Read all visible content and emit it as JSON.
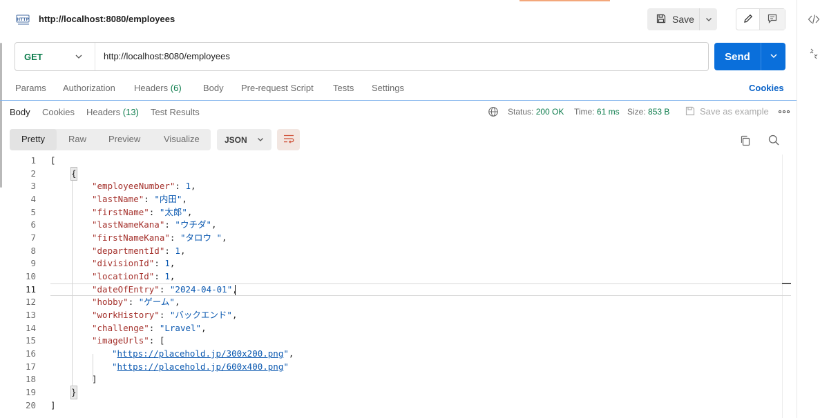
{
  "request": {
    "title": "http://localhost:8080/employees",
    "method": "GET",
    "url": "http://localhost:8080/employees",
    "save_label": "Save",
    "send_label": "Send"
  },
  "request_tabs": {
    "params": "Params",
    "authorization": "Authorization",
    "headers": "Headers",
    "headers_count": "(6)",
    "body": "Body",
    "prerequest": "Pre-request Script",
    "tests": "Tests",
    "settings": "Settings",
    "cookies": "Cookies"
  },
  "response_tabs": {
    "body": "Body",
    "cookies": "Cookies",
    "headers": "Headers",
    "headers_count": "(13)",
    "test_results": "Test Results"
  },
  "response_status": {
    "status_label": "Status:",
    "status_value": "200 OK",
    "time_label": "Time:",
    "time_value": "61 ms",
    "size_label": "Size:",
    "size_value": "853 B",
    "save_example": "Save as example"
  },
  "view_options": {
    "pretty": "Pretty",
    "raw": "Raw",
    "preview": "Preview",
    "visualize": "Visualize",
    "format": "JSON"
  },
  "code": {
    "line_numbers": [
      "1",
      "2",
      "3",
      "4",
      "5",
      "6",
      "7",
      "8",
      "9",
      "10",
      "11",
      "12",
      "13",
      "14",
      "15",
      "16",
      "17",
      "18",
      "19",
      "20"
    ],
    "l1": "[",
    "l2": "{",
    "l3_key": "\"employeeNumber\"",
    "l3_val": "1",
    "l4_key": "\"lastName\"",
    "l4_val": "\"内田\"",
    "l5_key": "\"firstName\"",
    "l5_val": "\"太郎\"",
    "l6_key": "\"lastNameKana\"",
    "l6_val": "\"ウチダ\"",
    "l7_key": "\"firstNameKana\"",
    "l7_val": "\"タロウ \"",
    "l8_key": "\"departmentId\"",
    "l8_val": "1",
    "l9_key": "\"divisionId\"",
    "l9_val": "1",
    "l10_key": "\"locationId\"",
    "l10_val": "1",
    "l11_key": "\"dateOfEntry\"",
    "l11_val": "\"2024-04-01\"",
    "l12_key": "\"hobby\"",
    "l12_val": "\"ゲーム\"",
    "l13_key": "\"workHistory\"",
    "l13_val": "\"バックエンド\"",
    "l14_key": "\"challenge\"",
    "l14_val": "\"Lravel\"",
    "l15_key": "\"imageUrls\"",
    "l15_val": "[",
    "l16_url": "https://placehold.jp/300x200.png",
    "l17_url": "https://placehold.jp/600x400.png",
    "l18": "]",
    "l19": "}",
    "l20": "]"
  },
  "colors": {
    "send": "#0a6fdb",
    "method_get": "#0a7b4a",
    "json_key": "#a5322d",
    "json_value": "#0a58b0",
    "status_ok": "#0a7b4a"
  }
}
